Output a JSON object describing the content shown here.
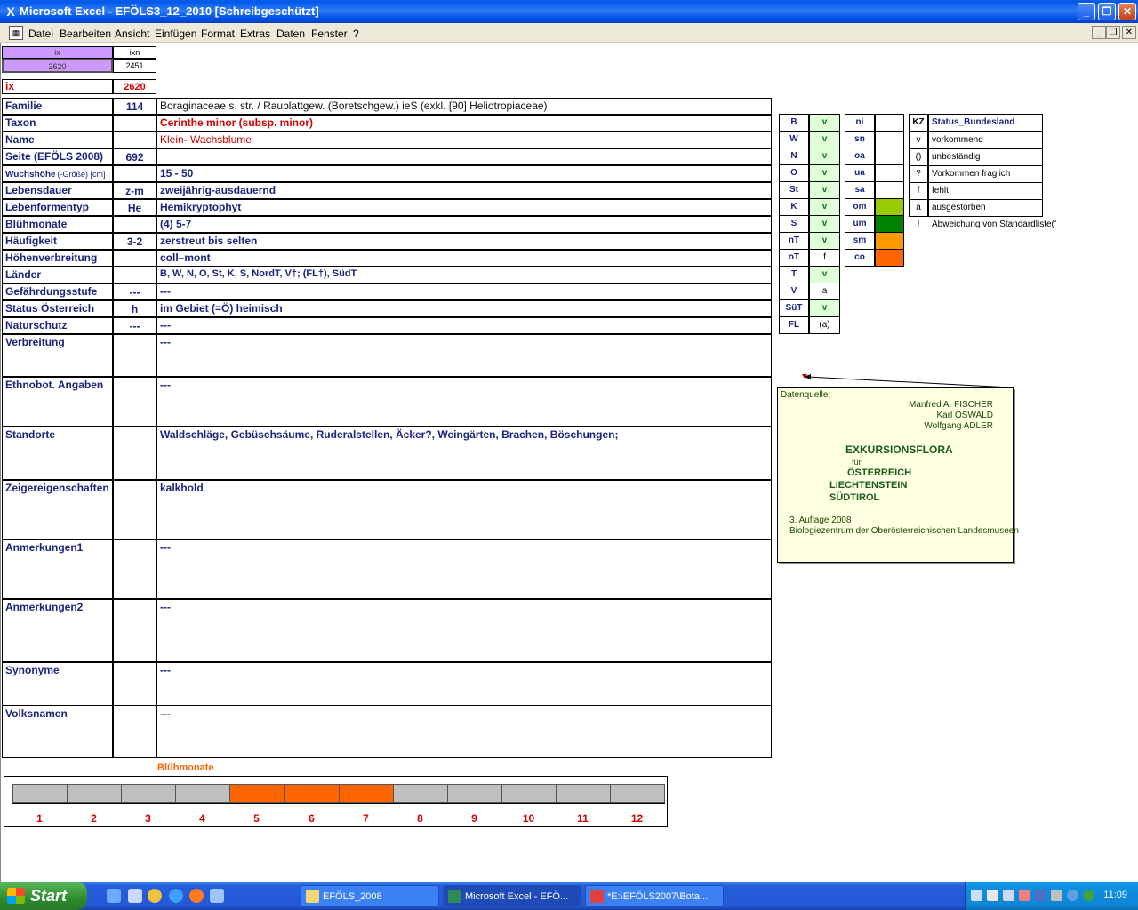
{
  "window": {
    "title": "Microsoft Excel - EFÖLS3_12_2010  [Schreibgeschützt]",
    "app_icon": "excel-icon",
    "controls": [
      "_",
      "❐",
      "✕"
    ]
  },
  "menu": {
    "items": [
      "Datei",
      "Bearbeiten",
      "Ansicht",
      "Einfügen",
      "Format",
      "Extras",
      "Daten",
      "Fenster",
      "?"
    ],
    "doc_controls": [
      "_",
      "❐",
      "✕"
    ]
  },
  "index": {
    "ix_header": "ix",
    "ixn_header": "ixn",
    "ix_value": "2620",
    "ixn_value": "2451",
    "ix_label": "ix",
    "ix_label_value": "2620"
  },
  "fields": [
    {
      "label": "Familie",
      "code": "114",
      "text": "Boraginaceae s. str.  /  Raublattgew. (Boretschgew.) ieS (exkl. [90] Heliotropiaceae)"
    },
    {
      "label": "Taxon",
      "code": "",
      "text": "Cerinthe minor (subsp. minor)"
    },
    {
      "label": "Name",
      "code": "",
      "text": "Klein- Wachsblume"
    },
    {
      "label": "Seite (EFÖLS 2008)",
      "code": "692",
      "text": ""
    },
    {
      "label": "Wuchshöhe",
      "label_suffix": "(-Größe) [cm]",
      "code": "",
      "text": " 15 - 50"
    },
    {
      "label": "Lebensdauer",
      "code": "z-m",
      "text": "zweijährig-ausdauernd"
    },
    {
      "label": "Lebenformentyp",
      "code": "He",
      "text": "Hemikryptophyt"
    },
    {
      "label": "Blühmonate",
      "code": "",
      "text": "(4) 5-7"
    },
    {
      "label": "Häufigkeit",
      "code": "3-2",
      "text": "zerstreut bis selten"
    },
    {
      "label": "Höhenverbreitung",
      "code": "",
      "text": "coll–mont"
    },
    {
      "label": "Länder",
      "code": "",
      "text": "B, W, N, O, St, K, S, NordT, V†; (FL†), SüdT"
    },
    {
      "label": "Gefährdungsstufe",
      "code": "---",
      "text": "  ---"
    },
    {
      "label": "Status Österreich",
      "code": "h",
      "text": "im Gebiet (=Ö) heimisch"
    },
    {
      "label": "Naturschutz",
      "code": "---",
      "text": "---"
    },
    {
      "label": "Verbreitung",
      "code": "",
      "text": "---"
    },
    {
      "label": "Ethnobot. Angaben",
      "code": "",
      "text": "---"
    },
    {
      "label": "Standorte",
      "code": "",
      "text": "Waldschläge, Gebüschsäume, Ruderalstellen, Äcker?, Weingärten, Brachen, Böschungen;"
    },
    {
      "label": "Zeigereigenschaften",
      "code": "",
      "text": "kalkhold"
    },
    {
      "label": "Anmerkungen1",
      "code": "",
      "text": "---"
    },
    {
      "label": "Anmerkungen2",
      "code": "",
      "text": "---"
    },
    {
      "label": "Synonyme",
      "code": "",
      "text": "---"
    },
    {
      "label": "Volksnamen",
      "code": "",
      "text": "---"
    }
  ],
  "bundeslaender": [
    {
      "kz": "B",
      "v": "v"
    },
    {
      "kz": "W",
      "v": "v"
    },
    {
      "kz": "N",
      "v": "v"
    },
    {
      "kz": "O",
      "v": "v"
    },
    {
      "kz": "St",
      "v": "v"
    },
    {
      "kz": "K",
      "v": "v"
    },
    {
      "kz": "S",
      "v": "v"
    },
    {
      "kz": "nT",
      "v": "v"
    },
    {
      "kz": "oT",
      "v": "f"
    },
    {
      "kz": "T",
      "v": "v"
    },
    {
      "kz": "V",
      "v": "a"
    },
    {
      "kz": "SüT",
      "v": "v"
    },
    {
      "kz": "FL",
      "v": "(a)"
    }
  ],
  "hoehenstufen": [
    {
      "code": "ni",
      "color": ""
    },
    {
      "code": "sn",
      "color": ""
    },
    {
      "code": "oa",
      "color": ""
    },
    {
      "code": "ua",
      "color": ""
    },
    {
      "code": "sa",
      "color": ""
    },
    {
      "code": "om",
      "color": "#99cc00"
    },
    {
      "code": "um",
      "color": "#008000"
    },
    {
      "code": "sm",
      "color": "#ff9900"
    },
    {
      "code": "co",
      "color": "#ff6600"
    }
  ],
  "status_legend": {
    "kz_header": "KZ",
    "title": "Status_Bundesland",
    "rows": [
      {
        "kz": "v",
        "text": "vorkommend"
      },
      {
        "kz": "()",
        "text": "unbeständig"
      },
      {
        "kz": "?",
        "text": "Vorkommen fraglich"
      },
      {
        "kz": "f",
        "text": "fehlt"
      },
      {
        "kz": "a",
        "text": "ausgestorben"
      },
      {
        "kz": "!",
        "text": "Abweichung von Standardliste(?)"
      }
    ]
  },
  "note": {
    "head": "Datenquelle:",
    "authors": [
      "Manfred A. FISCHER",
      "Karl OSWALD",
      "Wolfgang ADLER"
    ],
    "book1": "EXKURSIONSFLORA",
    "fuer": "für",
    "book2": "ÖSTERREICH",
    "book3": "LIECHTENSTEIN",
    "book4": "SÜDTIROL",
    "edition": "3. Auflage 2008",
    "publisher": "Biologiezentrum der Oberösterreichischen Landesmuseen"
  },
  "bloom_chart": {
    "title": "Blühmonate",
    "months": [
      "1",
      "2",
      "3",
      "4",
      "5",
      "6",
      "7",
      "8",
      "9",
      "10",
      "11",
      "12"
    ],
    "active": [
      false,
      false,
      false,
      false,
      true,
      true,
      true,
      false,
      false,
      false,
      false,
      false
    ],
    "color_active": "#ff6600",
    "color_inactive": "#c0c0c0"
  },
  "taskbar": {
    "start": "Start",
    "tasks": [
      "EFÖLS_2008",
      "Microsoft Excel - EFÖ...",
      "*E:\\EFÖLS2007\\Bota..."
    ],
    "clock": "11:09"
  }
}
